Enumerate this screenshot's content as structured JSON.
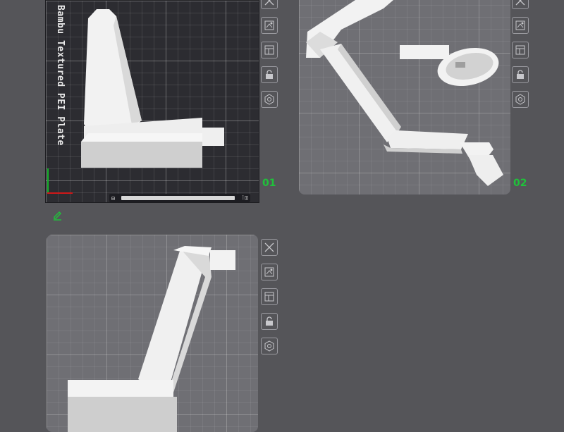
{
  "plates": [
    {
      "number": "01",
      "label": "Bambu Textured PEI Plate",
      "bottom_bar_left": "⊟",
      "bottom_bar_right": "⁞◫"
    },
    {
      "number": "02"
    },
    {
      "number": ""
    }
  ],
  "toolbar_icons": [
    "close-icon",
    "auto-orient-icon",
    "arrange-icon",
    "lock-icon",
    "settings-icon"
  ],
  "colors": {
    "background": "#555559",
    "plate_light": "#6f6f74",
    "plate_selected": "#2c2c31",
    "plate_number": "#1fc23a",
    "model": "#f2f2f2",
    "model_shade": "#c8c8c8",
    "edit_icon": "#1fc23a"
  }
}
